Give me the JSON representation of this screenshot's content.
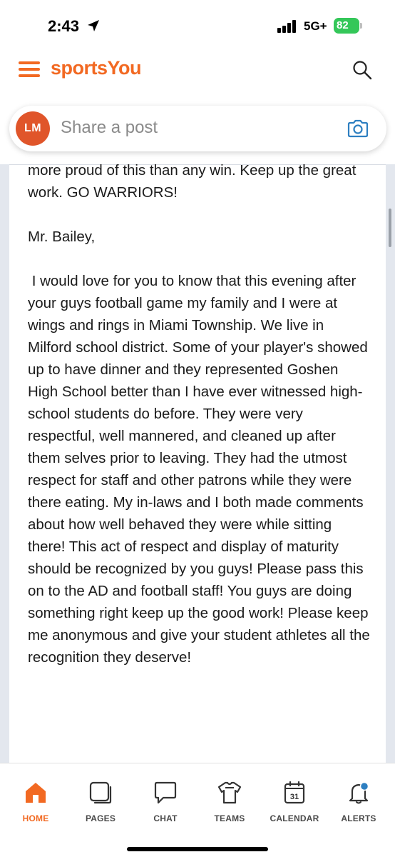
{
  "status_bar": {
    "time": "2:43",
    "network": "5G+",
    "battery": "82"
  },
  "header": {
    "brand": "sportsYou",
    "brand_color": "#f26922"
  },
  "share_bar": {
    "avatar_initials": "LM",
    "avatar_color": "#e0552a",
    "placeholder": "Share a post"
  },
  "post": {
    "paragraphs": [
      "more proud of this than any win. Keep up the great work. GO WARRIORS!",
      "Mr. Bailey,",
      " I would love for you to know that this evening after your guys football game my family and I were at wings and rings in Miami Township. We live in Milford school district. Some of your player's showed up to have dinner and they represented Goshen High School better than I have ever witnessed high-school students do before. They were very respectful, well mannered, and cleaned up after them selves prior to leaving. They had the utmost respect for staff and other patrons while they were there eating. My in-laws and I both made comments about how well behaved they were while sitting there! This act of respect and display of maturity should be recognized by you guys! Please pass this on to the AD and football staff! You guys are doing something right keep up the good work! Please keep me anonymous and give your student athletes all the recognition they deserve!"
    ]
  },
  "tabs": [
    {
      "label": "HOME",
      "icon": "home-icon",
      "active": true
    },
    {
      "label": "PAGES",
      "icon": "pages-icon",
      "active": false
    },
    {
      "label": "CHAT",
      "icon": "chat-icon",
      "active": false
    },
    {
      "label": "TEAMS",
      "icon": "teams-icon",
      "active": false
    },
    {
      "label": "CALENDAR",
      "icon": "calendar-icon",
      "active": false,
      "badge_text": "31"
    },
    {
      "label": "ALERTS",
      "icon": "alerts-icon",
      "active": false
    }
  ]
}
